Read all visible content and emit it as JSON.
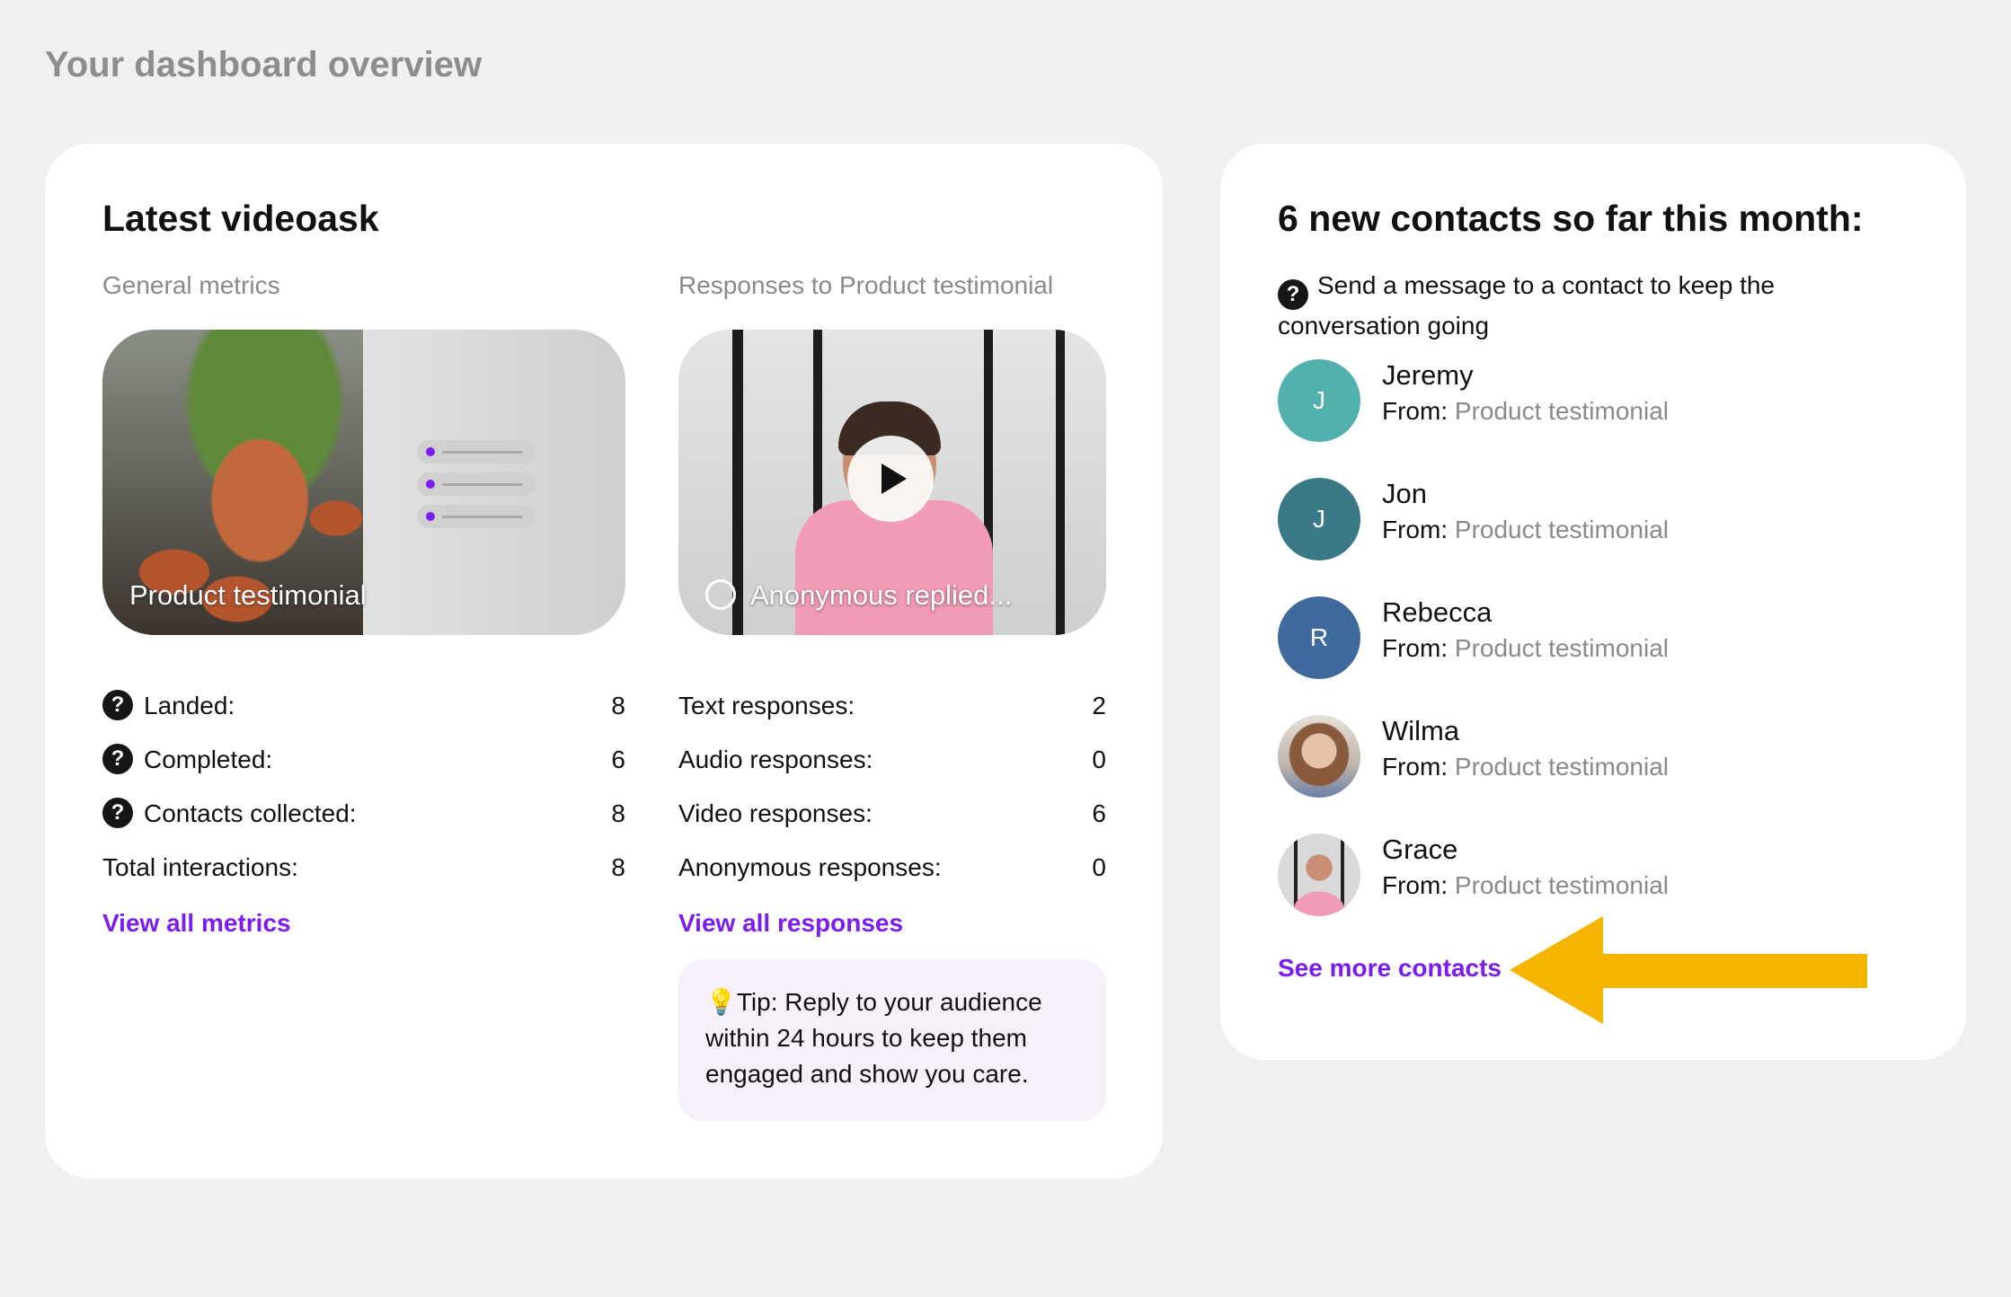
{
  "page": {
    "title": "Your dashboard overview"
  },
  "main_card": {
    "title": "Latest videoask",
    "general": {
      "subhead": "General metrics",
      "video_caption": "Product testimonial",
      "metrics": [
        {
          "label": "Landed:",
          "value": "8",
          "help": true
        },
        {
          "label": "Completed:",
          "value": "6",
          "help": true
        },
        {
          "label": "Contacts collected:",
          "value": "8",
          "help": true
        },
        {
          "label": "Total interactions:",
          "value": "8",
          "help": false
        }
      ],
      "link": "View all metrics"
    },
    "responses": {
      "subhead": "Responses to Product testimonial",
      "video_caption": "Anonymous replied...",
      "metrics": [
        {
          "label": "Text responses:",
          "value": "2"
        },
        {
          "label": "Audio responses:",
          "value": "0"
        },
        {
          "label": "Video responses:",
          "value": "6"
        },
        {
          "label": "Anonymous responses:",
          "value": "0"
        }
      ],
      "link": "View all responses",
      "tip": "💡Tip: Reply to your audience within 24 hours to keep them engaged and show you care."
    }
  },
  "contacts_card": {
    "title": "6 new contacts so far this month:",
    "hint": "Send a message to a contact to keep the conversation going",
    "from_label": "From:",
    "contacts": [
      {
        "name": "Jeremy",
        "initial": "J",
        "color": "#52b0ad",
        "source": "Product testimonial"
      },
      {
        "name": "Jon",
        "initial": "J",
        "color": "#3a7a87",
        "source": "Product testimonial"
      },
      {
        "name": "Rebecca",
        "initial": "R",
        "color": "#3f6a9e",
        "source": "Product testimonial"
      },
      {
        "name": "Wilma",
        "initial": "",
        "color": "",
        "source": "Product testimonial"
      },
      {
        "name": "Grace",
        "initial": "",
        "color": "",
        "source": "Product testimonial"
      }
    ],
    "link": "See more contacts"
  },
  "colors": {
    "accent": "#7b1cf0",
    "arrow": "#f5b400",
    "background": "#f0f0f0"
  },
  "icons": {
    "help": "?",
    "play": "play-icon",
    "reply": "reply-icon"
  }
}
